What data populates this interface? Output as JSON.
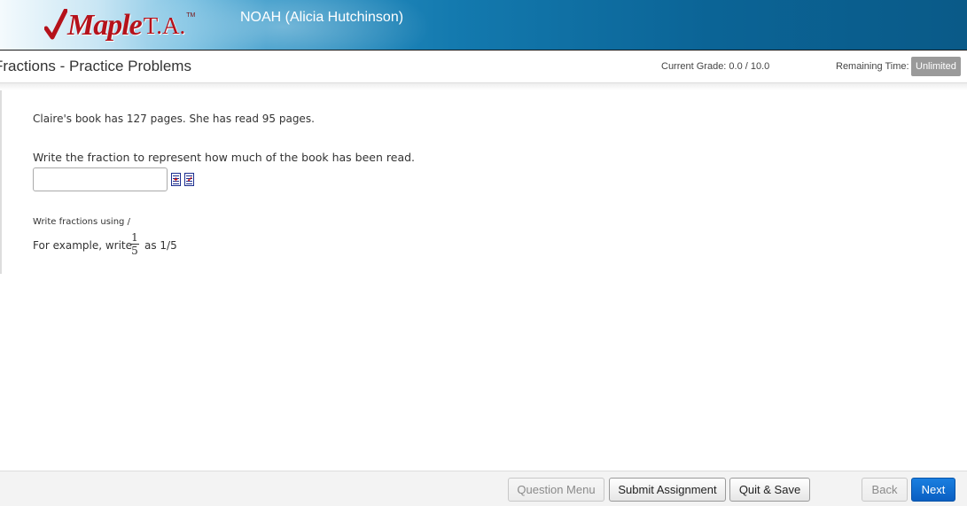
{
  "header": {
    "logo_text": "Maple",
    "logo_ta": "T.A.",
    "logo_tm": "TM",
    "user": "NOAH (Alicia Hutchinson)"
  },
  "titlebar": {
    "title": "Fractions - Practice Problems",
    "grade": "Current Grade: 0.0 / 10.0",
    "time_label": "Remaining Time:",
    "time_value": "Unlimited"
  },
  "question": {
    "statement": "Claire's book has 127 pages. She has read 95 pages.",
    "prompt": "Write the fraction to represent how much of the book has been read.",
    "answer_value": "",
    "hint_line1": "Write fractions using /",
    "hint_line2_prefix": "For example, write",
    "example_numerator": "1",
    "example_denominator": "5",
    "hint_line2_suffix": "as 1/5"
  },
  "footer": {
    "question_menu": "Question Menu",
    "submit": "Submit Assignment",
    "quit_save": "Quit & Save",
    "back": "Back",
    "next": "Next"
  },
  "colors": {
    "brand_red": "#b5121b",
    "header_blue": "#0b6496",
    "next_blue": "#0a5fc2",
    "badge_gray": "#9a9a9a"
  },
  "icons": [
    "checkmark-logo-icon",
    "equation-editor-icon",
    "preview-icon"
  ]
}
